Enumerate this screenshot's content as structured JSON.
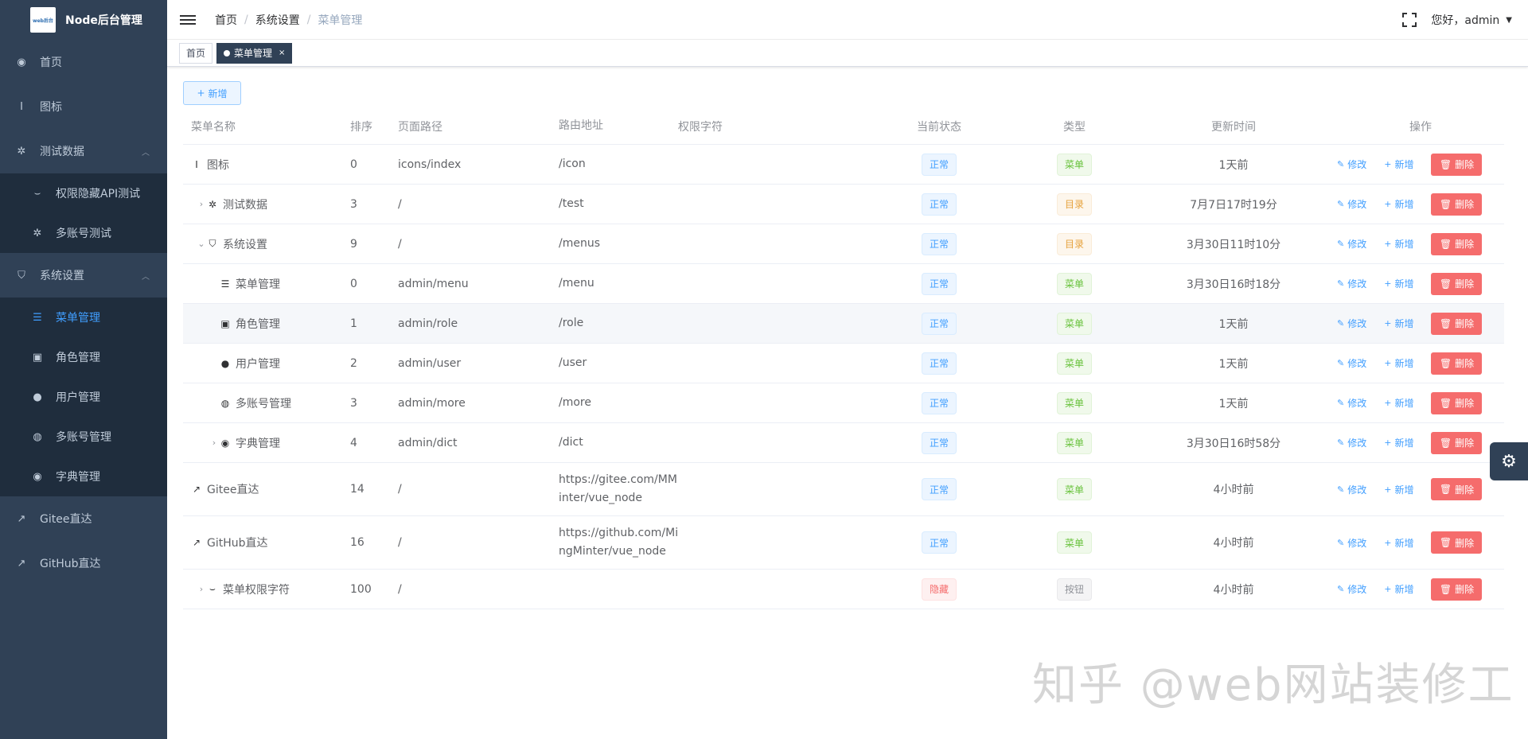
{
  "app": {
    "title": "Node后台管理",
    "logo_text": "web后台"
  },
  "sidebar": {
    "items": [
      {
        "label": "首页",
        "icon": "dashboard-icon",
        "glyph": "◉"
      },
      {
        "label": "图标",
        "icon": "icon-book-icon",
        "glyph": "I"
      },
      {
        "label": "测试数据",
        "icon": "bug-icon",
        "glyph": "✲",
        "expanded": true
      },
      {
        "label": "权限隐藏API测试",
        "icon": "eye-closed-icon",
        "glyph": "⌣",
        "sub": true
      },
      {
        "label": "多账号测试",
        "icon": "bug-icon",
        "glyph": "✲",
        "sub": true
      },
      {
        "label": "系统设置",
        "icon": "shield-icon",
        "glyph": "⛉",
        "expanded": true
      },
      {
        "label": "菜单管理",
        "icon": "list-icon",
        "glyph": "☰",
        "sub": true,
        "active": true
      },
      {
        "label": "角色管理",
        "icon": "id-card-icon",
        "glyph": "▣",
        "sub": true
      },
      {
        "label": "用户管理",
        "icon": "user-icon",
        "glyph": "●",
        "sub": true
      },
      {
        "label": "多账号管理",
        "icon": "users-icon",
        "glyph": "◍",
        "sub": true
      },
      {
        "label": "字典管理",
        "icon": "dashboard-icon",
        "glyph": "◉",
        "sub": true
      },
      {
        "label": "Gitee直达",
        "icon": "external-link-icon",
        "glyph": "↗"
      },
      {
        "label": "GitHub直达",
        "icon": "external-link-icon",
        "glyph": "↗"
      }
    ]
  },
  "header": {
    "breadcrumb": [
      "首页",
      "系统设置",
      "菜单管理"
    ],
    "greeting": "您好，admin"
  },
  "tags": [
    {
      "label": "首页",
      "active": false
    },
    {
      "label": "菜单管理",
      "active": true
    }
  ],
  "toolbar": {
    "add_label": "新增"
  },
  "table": {
    "columns": [
      "菜单名称",
      "排序",
      "页面路径",
      "路由地址",
      "权限字符",
      "当前状态",
      "类型",
      "更新时间",
      "操作"
    ],
    "op_labels": {
      "edit": "修改",
      "add": "新增",
      "delete": "删除"
    },
    "rows": [
      {
        "name": "图标",
        "indent": 0,
        "arrow": "",
        "glyph": "I",
        "sort": "0",
        "component": "icons/index",
        "path_lines": [
          "/icon"
        ],
        "perm": "",
        "status": "正常",
        "status_color": "blue",
        "type": "菜单",
        "type_color": "green",
        "time": "1天前",
        "tall": false,
        "hl": false
      },
      {
        "name": "测试数据",
        "indent": 1,
        "arrow": "›",
        "glyph": "✲",
        "sort": "3",
        "component": "/",
        "path_lines": [
          "/test"
        ],
        "perm": "",
        "status": "正常",
        "status_color": "blue",
        "type": "目录",
        "type_color": "yellow",
        "time": "7月7日17时19分",
        "tall": false,
        "hl": false
      },
      {
        "name": "系统设置",
        "indent": 1,
        "arrow": "⌄",
        "glyph": "⛉",
        "sort": "9",
        "component": "/",
        "path_lines": [
          "/menus"
        ],
        "perm": "",
        "status": "正常",
        "status_color": "blue",
        "type": "目录",
        "type_color": "yellow",
        "time": "3月30日11时10分",
        "tall": false,
        "hl": false
      },
      {
        "name": "菜单管理",
        "indent": 2,
        "arrow": "",
        "glyph": "☰",
        "sort": "0",
        "component": "admin/menu",
        "path_lines": [
          "/menu"
        ],
        "perm": "",
        "status": "正常",
        "status_color": "blue",
        "type": "菜单",
        "type_color": "green",
        "time": "3月30日16时18分",
        "tall": false,
        "hl": false
      },
      {
        "name": "角色管理",
        "indent": 2,
        "arrow": "",
        "glyph": "▣",
        "sort": "1",
        "component": "admin/role",
        "path_lines": [
          "/role"
        ],
        "perm": "",
        "status": "正常",
        "status_color": "blue",
        "type": "菜单",
        "type_color": "green",
        "time": "1天前",
        "tall": false,
        "hl": true
      },
      {
        "name": "用户管理",
        "indent": 2,
        "arrow": "",
        "glyph": "●",
        "sort": "2",
        "component": "admin/user",
        "path_lines": [
          "/user"
        ],
        "perm": "",
        "status": "正常",
        "status_color": "blue",
        "type": "菜单",
        "type_color": "green",
        "time": "1天前",
        "tall": false,
        "hl": false
      },
      {
        "name": "多账号管理",
        "indent": 2,
        "arrow": "",
        "glyph": "◍",
        "sort": "3",
        "component": "admin/more",
        "path_lines": [
          "/more"
        ],
        "perm": "",
        "status": "正常",
        "status_color": "blue",
        "type": "菜单",
        "type_color": "green",
        "time": "1天前",
        "tall": false,
        "hl": false
      },
      {
        "name": "字典管理",
        "indent": 2,
        "arrow": "›",
        "glyph": "◉",
        "sort": "4",
        "component": "admin/dict",
        "path_lines": [
          "/dict"
        ],
        "perm": "",
        "status": "正常",
        "status_color": "blue",
        "type": "菜单",
        "type_color": "green",
        "time": "3月30日16时58分",
        "tall": false,
        "hl": false
      },
      {
        "name": "Gitee直达",
        "indent": 0,
        "arrow": "",
        "glyph": "↗",
        "sort": "14",
        "component": "/",
        "path_lines": [
          "https://gitee.com/MM",
          "inter/vue_node"
        ],
        "perm": "",
        "status": "正常",
        "status_color": "blue",
        "type": "菜单",
        "type_color": "green",
        "time": "4小时前",
        "tall": true,
        "hl": false
      },
      {
        "name": "GitHub直达",
        "indent": 0,
        "arrow": "",
        "glyph": "↗",
        "sort": "16",
        "component": "/",
        "path_lines": [
          "https://github.com/Mi",
          "ngMinter/vue_node"
        ],
        "perm": "",
        "status": "正常",
        "status_color": "blue",
        "type": "菜单",
        "type_color": "green",
        "time": "4小时前",
        "tall": true,
        "hl": false
      },
      {
        "name": "菜单权限字符",
        "indent": 1,
        "arrow": "›",
        "glyph": "⌣",
        "sort": "100",
        "component": "/",
        "path_lines": [],
        "perm": "",
        "status": "隐藏",
        "status_color": "red",
        "type": "按钮",
        "type_color": "gray",
        "time": "4小时前",
        "tall": false,
        "hl": false
      }
    ]
  },
  "watermark": "知乎 @web网站装修工"
}
